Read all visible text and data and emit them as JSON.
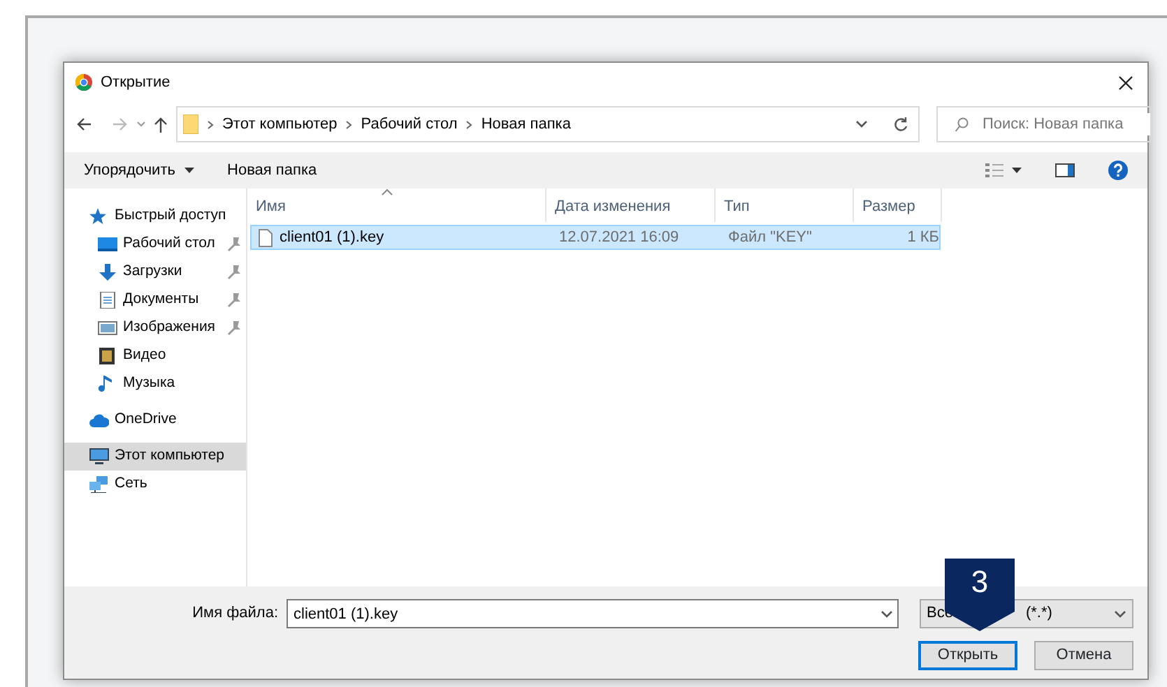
{
  "dialog": {
    "title": "Открытие",
    "breadcrumb": [
      "Этот компьютер",
      "Рабочий стол",
      "Новая папка"
    ],
    "search": {
      "placeholder": "Поиск: Новая папка"
    },
    "toolbar": {
      "organize": "Упорядочить",
      "new_folder": "Новая папка"
    },
    "sidebar": [
      {
        "label": "Быстрый доступ",
        "kind": "star",
        "selected": false,
        "pinned": false,
        "children": [
          {
            "label": "Рабочий стол",
            "kind": "desktop",
            "selected": false,
            "pinned": true
          },
          {
            "label": "Загрузки",
            "kind": "download",
            "selected": false,
            "pinned": true
          },
          {
            "label": "Документы",
            "kind": "document",
            "selected": false,
            "pinned": true
          },
          {
            "label": "Изображения",
            "kind": "image",
            "selected": false,
            "pinned": true
          },
          {
            "label": "Видео",
            "kind": "video",
            "selected": false,
            "pinned": false
          },
          {
            "label": "Музыка",
            "kind": "music",
            "selected": false,
            "pinned": false
          }
        ]
      },
      {
        "label": "OneDrive",
        "kind": "cloud",
        "selected": false,
        "pinned": false
      },
      {
        "label": "Этот компьютер",
        "kind": "computer",
        "selected": true,
        "pinned": false
      },
      {
        "label": "Сеть",
        "kind": "network",
        "selected": false,
        "pinned": false
      }
    ],
    "columns": [
      {
        "label": "Имя",
        "sorted": true
      },
      {
        "label": "Дата изменения",
        "sorted": false
      },
      {
        "label": "Тип",
        "sorted": false
      },
      {
        "label": "Размер",
        "sorted": false
      }
    ],
    "files": [
      {
        "name": "client01 (1).key",
        "modified": "12.07.2021 16:09",
        "type": "Файл \"KEY\"",
        "size": "1 КБ",
        "selected": true
      }
    ],
    "filename": {
      "label": "Имя файла:",
      "value": "client01 (1).key"
    },
    "filter": {
      "start": "Все",
      "end": "(*.*)"
    },
    "buttons": [
      {
        "label": "Открыть",
        "default": true
      },
      {
        "label": "Отмена",
        "default": false
      }
    ]
  },
  "step_badge": "3"
}
